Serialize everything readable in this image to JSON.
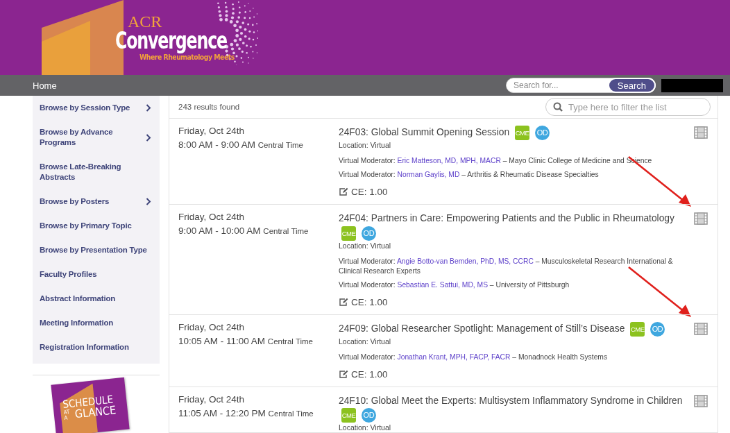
{
  "header": {
    "logo": {
      "acr": "ACR",
      "name": "Convergence",
      "tagline": "Where Rheumatology Meets"
    }
  },
  "nav": {
    "items": [
      "Home"
    ],
    "search": {
      "placeholder": "Search for...",
      "button": "Search"
    }
  },
  "sidebar": {
    "items": [
      {
        "label": "Browse by Session Type",
        "has_submenu": true
      },
      {
        "label": "Browse by Advance Programs",
        "has_submenu": true
      },
      {
        "label": "Browse Late-Breaking Abstracts",
        "has_submenu": false
      },
      {
        "label": "Browse by Posters",
        "has_submenu": true
      },
      {
        "label": "Browse by Primary Topic",
        "has_submenu": false
      },
      {
        "label": "Browse by Presentation Type",
        "has_submenu": false
      },
      {
        "label": "Faculty Profiles",
        "has_submenu": false
      },
      {
        "label": "Abstract Information",
        "has_submenu": false
      },
      {
        "label": "Meeting Information",
        "has_submenu": false
      },
      {
        "label": "Registration Information",
        "has_submenu": false
      }
    ],
    "promo": {
      "lines": [
        "SCHEDULE",
        "AT A",
        "GLANCE"
      ]
    }
  },
  "results": {
    "count": "243 results found",
    "filter": {
      "placeholder": "Type here to filter the list"
    }
  },
  "sessions": [
    {
      "date": "Friday, Oct 24th",
      "time": "8:00 AM - 9:00 AM",
      "timezone": "Central Time",
      "title": "24F03: Global Summit Opening Session",
      "badges": [
        "CME",
        "OD"
      ],
      "location": "Location: Virtual",
      "moderators": [
        {
          "role": "Virtual Moderator:",
          "name": "Eric Matteson, MD, MPH, MACR",
          "affiliation": "– Mayo Clinic College of Medicine and Science"
        },
        {
          "role": "Virtual Moderator:",
          "name": "Norman Gaylis, MD",
          "affiliation": "– Arthritis & Rheumatic Disease Specialties"
        }
      ],
      "ce": "CE: 1.00",
      "arrow": true
    },
    {
      "date": "Friday, Oct 24th",
      "time": "9:00 AM - 10:00 AM",
      "timezone": "Central Time",
      "title": "24F04: Partners in Care: Empowering Patients and the Public in Rheumatology",
      "badges": [
        "CME",
        "OD"
      ],
      "location": "Location: Virtual",
      "moderators": [
        {
          "role": "Virtual Moderator:",
          "name": "Angie Botto-van Bemden, PhD, MS, CCRC",
          "affiliation": "– Musculoskeletal Research International & Clinical Research Experts"
        },
        {
          "role": "Virtual Moderator:",
          "name": "Sebastian E. Sattui, MD, MS",
          "affiliation": "– University of Pittsburgh"
        }
      ],
      "ce": "CE: 1.00",
      "arrow": true
    },
    {
      "date": "Friday, Oct 24th",
      "time": "10:05 AM - 11:00 AM",
      "timezone": "Central Time",
      "title": "24F09: Global Researcher Spotlight: Management of Still’s Disease",
      "badges": [
        "CME",
        "OD"
      ],
      "location": "Location: Virtual",
      "moderators": [
        {
          "role": "Virtual Moderator:",
          "name": "Jonathan Krant, MPH, FACP, FACR",
          "affiliation": "– Monadnock Health Systems"
        }
      ],
      "ce": "CE: 1.00",
      "arrow": false
    },
    {
      "date": "Friday, Oct 24th",
      "time": "11:05 AM - 12:20 PM",
      "timezone": "Central Time",
      "title": "24F10: Global Meet the Experts: Multisystem Inflammatory Syndrome in Children",
      "badges": [
        "CME",
        "OD"
      ],
      "location": "Location: Virtual",
      "arrow": false
    }
  ]
}
